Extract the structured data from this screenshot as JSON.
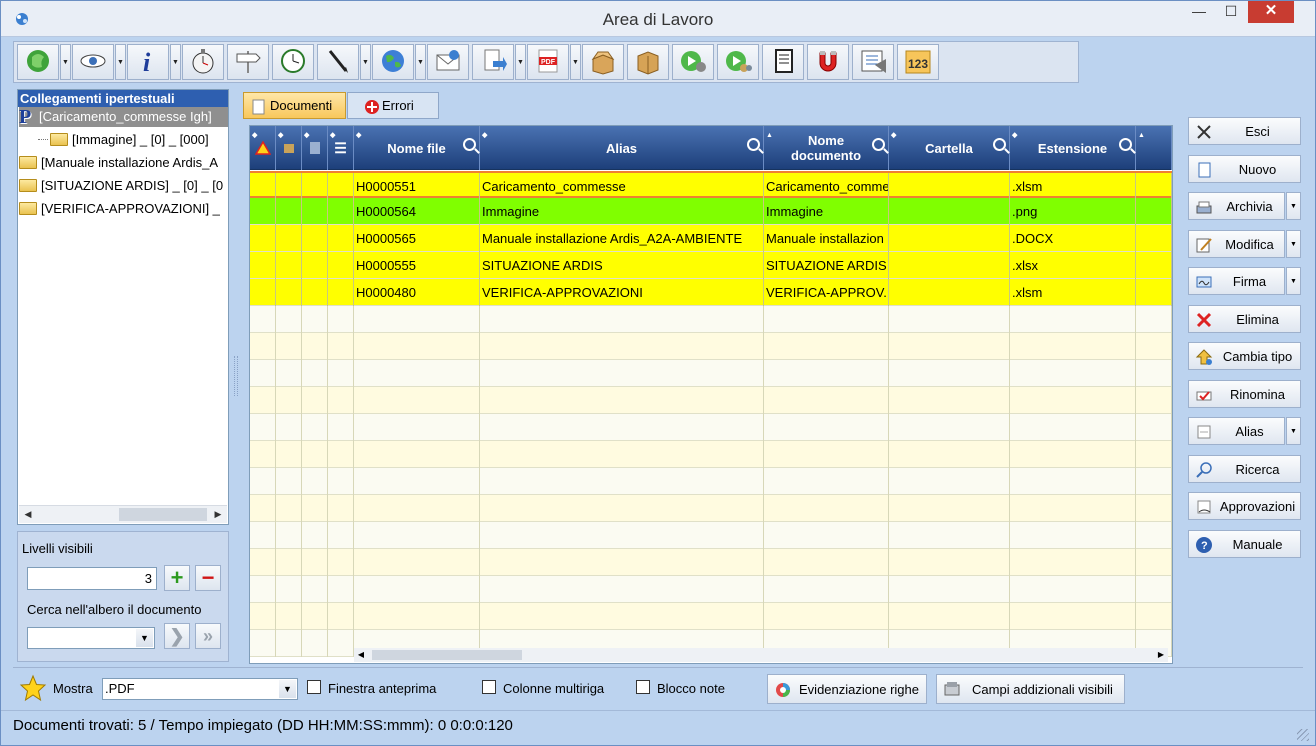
{
  "window": {
    "title": "Area di Lavoro",
    "minimize": "—",
    "maximize": "☐",
    "close": "✕"
  },
  "toolbar": {
    "buttons": [
      {
        "icon": "green-globe-icon",
        "dd": true
      },
      {
        "icon": "eye-icon",
        "dd": true
      },
      {
        "icon": "info-icon",
        "dd": true
      },
      {
        "icon": "stopwatch-icon",
        "dd": false
      },
      {
        "icon": "signpost-icon",
        "dd": false
      },
      {
        "icon": "clock-icon",
        "dd": false
      },
      {
        "icon": "pen-icon",
        "dd": true
      },
      {
        "icon": "world-icon",
        "dd": true
      },
      {
        "icon": "email-icon",
        "dd": false
      },
      {
        "icon": "document-export-icon",
        "dd": true
      },
      {
        "icon": "pdf-icon",
        "dd": true
      },
      {
        "icon": "open-box-icon",
        "dd": false
      },
      {
        "icon": "closed-box-icon",
        "dd": false
      },
      {
        "icon": "play-user-icon",
        "dd": false
      },
      {
        "icon": "play-group-icon",
        "dd": false
      },
      {
        "icon": "binder-icon",
        "dd": false
      },
      {
        "icon": "magnet-icon",
        "dd": false
      },
      {
        "icon": "checklist-icon",
        "dd": false
      },
      {
        "icon": "counter-123-icon",
        "dd": false
      }
    ]
  },
  "left_panel": {
    "header": "Collegamenti ipertestuali",
    "tree": [
      {
        "label": "[Caricamento_commesse  Igh]",
        "level": 0,
        "selected": true,
        "icon": "p-root-icon"
      },
      {
        "label": "[Immagine] _ [0] _ [000]",
        "level": 1,
        "selected": false,
        "icon": "folder-icon"
      },
      {
        "label": "[Manuale installazione Ardis_A",
        "level": 0,
        "selected": false,
        "icon": "folder-icon"
      },
      {
        "label": "[SITUAZIONE ARDIS] _ [0] _ [0",
        "level": 0,
        "selected": false,
        "icon": "folder-icon"
      },
      {
        "label": "[VERIFICA-APPROVAZIONI] _",
        "level": 0,
        "selected": false,
        "icon": "folder-icon"
      }
    ],
    "levels_label": "Livelli visibili",
    "levels_value": "3",
    "search_label": "Cerca nell'albero il documento",
    "search_value": ""
  },
  "tabs": [
    {
      "label": "Documenti",
      "active": true
    },
    {
      "label": "Errori",
      "active": false
    }
  ],
  "grid": {
    "columns": [
      "",
      "",
      "",
      "",
      "Nome file",
      "Alias",
      "Nome documento",
      "Cartella",
      "Estensione",
      ""
    ],
    "rows": [
      {
        "nome_file": "H0000551",
        "alias": "Caricamento_commesse",
        "nome_documento": "Caricamento_comme",
        "cartella": "",
        "estensione": ".xlsm",
        "color": "#ffff00",
        "selected": true
      },
      {
        "nome_file": "H0000564",
        "alias": "Immagine",
        "nome_documento": "Immagine",
        "cartella": "",
        "estensione": ".png",
        "color": "#80ff00",
        "selected": false
      },
      {
        "nome_file": "H0000565",
        "alias": "Manuale installazione Ardis_A2A-AMBIENTE",
        "nome_documento": "Manuale installazion",
        "cartella": "",
        "estensione": ".DOCX",
        "color": "#ffff00",
        "selected": false
      },
      {
        "nome_file": "H0000555",
        "alias": "SITUAZIONE ARDIS",
        "nome_documento": "SITUAZIONE ARDIS",
        "cartella": "",
        "estensione": ".xlsx",
        "color": "#ffff00",
        "selected": false
      },
      {
        "nome_file": "H0000480",
        "alias": "VERIFICA-APPROVAZIONI",
        "nome_documento": "VERIFICA-APPROV.",
        "cartella": "",
        "estensione": ".xlsm",
        "color": "#ffff00",
        "selected": false
      }
    ],
    "empty_row_count": 13
  },
  "right_buttons": [
    {
      "label": "Esci",
      "icon": "close-x-icon",
      "dd": false
    },
    {
      "label": "Nuovo",
      "icon": "new-document-icon",
      "dd": false
    },
    {
      "label": "Archivia",
      "icon": "archive-icon",
      "dd": true
    },
    {
      "label": "Modifica",
      "icon": "edit-icon",
      "dd": true
    },
    {
      "label": "Firma",
      "icon": "signature-icon",
      "dd": true
    },
    {
      "label": "Elimina",
      "icon": "delete-icon",
      "dd": false
    },
    {
      "label": "Cambia tipo",
      "icon": "change-type-icon",
      "dd": false
    },
    {
      "label": "Rinomina",
      "icon": "rename-icon",
      "dd": false
    },
    {
      "label": "Alias",
      "icon": "alias-icon",
      "dd": true
    },
    {
      "label": "Ricerca",
      "icon": "search-icon",
      "dd": false
    },
    {
      "label": "Approvazioni",
      "icon": "approval-icon",
      "dd": false
    },
    {
      "label": "Manuale",
      "icon": "help-icon",
      "dd": false
    }
  ],
  "bottom": {
    "mostra_label": "Mostra",
    "mostra_value": ".PDF",
    "finestra_anteprima": "Finestra anteprima",
    "colonne_multiriga": "Colonne multiriga",
    "blocco_note": "Blocco note",
    "evidenziazione": "Evidenziazione righe",
    "campi_addizionali": "Campi addizionali visibili"
  },
  "status": {
    "text": "Documenti trovati: 5 / Tempo impiegato (DD HH:MM:SS:mmm):  0 0:0:0:120"
  }
}
